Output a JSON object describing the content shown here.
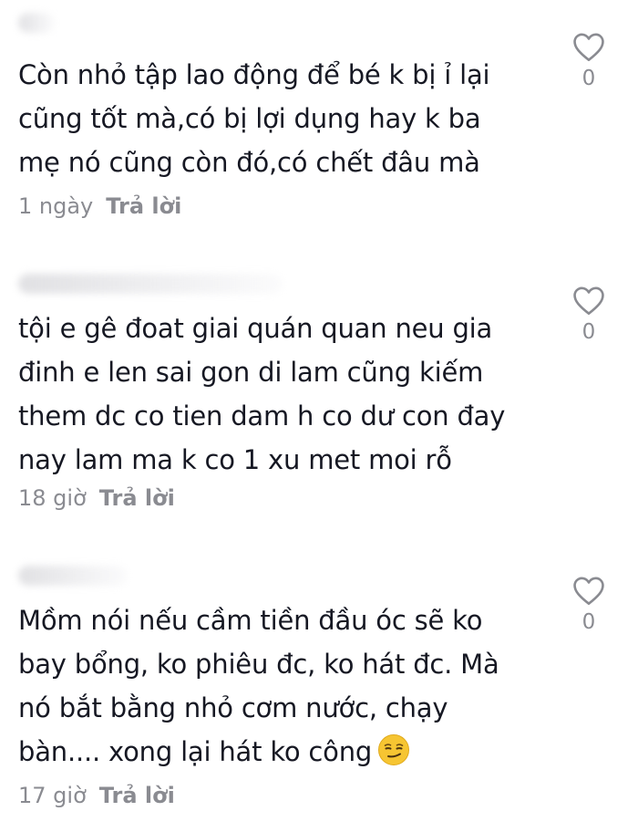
{
  "comments": [
    {
      "lines": [
        "Còn nhỏ tập lao động để bé k bị ỉ lại",
        "cũng tốt mà,có bị lợi dụng hay k ba",
        "mẹ nó cũng còn đó,có chết đâu mà"
      ],
      "time": "1 ngày",
      "reply_label": "Trả lời",
      "likes": "0",
      "like_icon": "heart-outline-icon"
    },
    {
      "lines": [
        "tội e gê đoat giai quán quan neu gia",
        "đinh e len sai gon di lam cũng kiếm",
        "them dc co tien dam h co dư con đay",
        "nay lam ma k co 1 xu met moi rỗ"
      ],
      "time": "18 giờ",
      "reply_label": "Trả lời",
      "likes": "0",
      "like_icon": "heart-outline-icon"
    },
    {
      "lines": [
        "Mồm nói nếu cầm tiền đầu óc sẽ ko",
        "bay bổng, ko phiêu đc, ko hát đc. Mà",
        "nó bắt bằng nhỏ cơm nước, chạy",
        "bàn.... xong lại hát ko công"
      ],
      "time": "17 giờ",
      "reply_label": "Trả lời",
      "likes": "0",
      "like_icon": "heart-outline-icon",
      "emoji": "smirking-face-emoji"
    }
  ],
  "colors": {
    "text": "#161823",
    "muted": "#8a8b91",
    "emoji_face": "#f6c532"
  }
}
